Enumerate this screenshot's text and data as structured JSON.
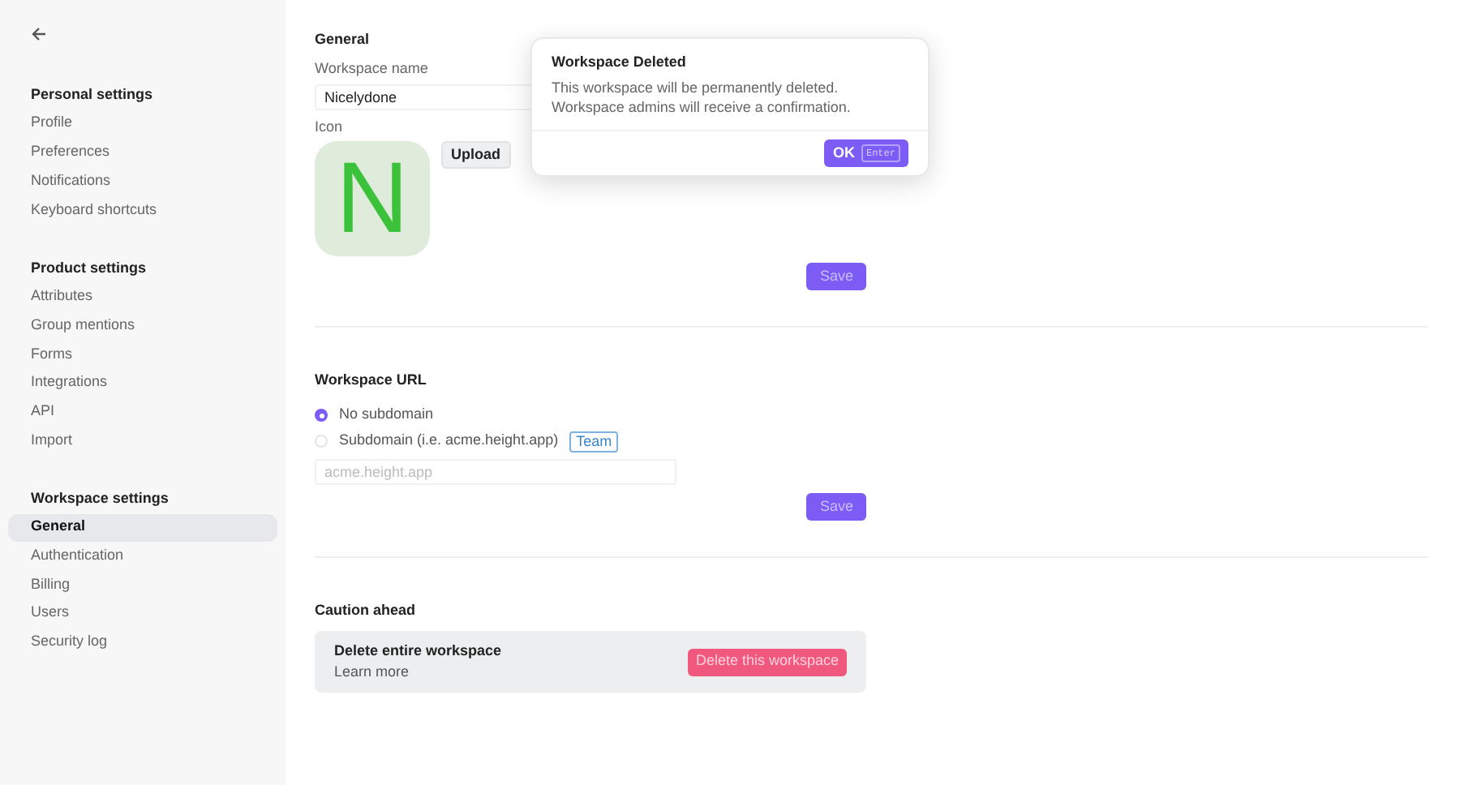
{
  "sidebar": {
    "groups": [
      {
        "title": "Personal settings",
        "items": [
          {
            "label": "Profile",
            "selected": false
          },
          {
            "label": "Preferences",
            "selected": false
          },
          {
            "label": "Notifications",
            "selected": false
          },
          {
            "label": "Keyboard shortcuts",
            "selected": false
          }
        ]
      },
      {
        "title": "Product settings",
        "items": [
          {
            "label": "Attributes",
            "selected": false
          },
          {
            "label": "Group mentions",
            "selected": false
          },
          {
            "label": "Forms",
            "selected": false
          },
          {
            "label": "Integrations",
            "selected": false
          },
          {
            "label": "API",
            "selected": false
          },
          {
            "label": "Import",
            "selected": false
          }
        ]
      },
      {
        "title": "Workspace settings",
        "items": [
          {
            "label": "General",
            "selected": true
          },
          {
            "label": "Authentication",
            "selected": false
          },
          {
            "label": "Billing",
            "selected": false
          },
          {
            "label": "Users",
            "selected": false
          },
          {
            "label": "Security log",
            "selected": false
          }
        ]
      }
    ]
  },
  "general": {
    "title": "General",
    "name_label": "Workspace name",
    "name_value": "Nicelydone",
    "icon_label": "Icon",
    "icon_letter": "N",
    "upload_button": "Upload",
    "save_button": "Save"
  },
  "workspace_url": {
    "title": "Workspace URL",
    "options": [
      {
        "label": "No subdomain",
        "selected": true
      },
      {
        "label": "Subdomain (i.e. acme.height.app)",
        "selected": false,
        "badge": "Team"
      }
    ],
    "placeholder": "acme.height.app",
    "save_button": "Save"
  },
  "caution": {
    "title": "Caution ahead",
    "card_title": "Delete entire workspace",
    "link": "Learn more",
    "delete_button": "Delete this workspace"
  },
  "dialog": {
    "title": "Workspace Deleted",
    "lines": [
      "This workspace will be permanently deleted.",
      "Workspace admins will receive a confirmation."
    ],
    "ok_button": "OK",
    "shortcut": "Enter"
  }
}
